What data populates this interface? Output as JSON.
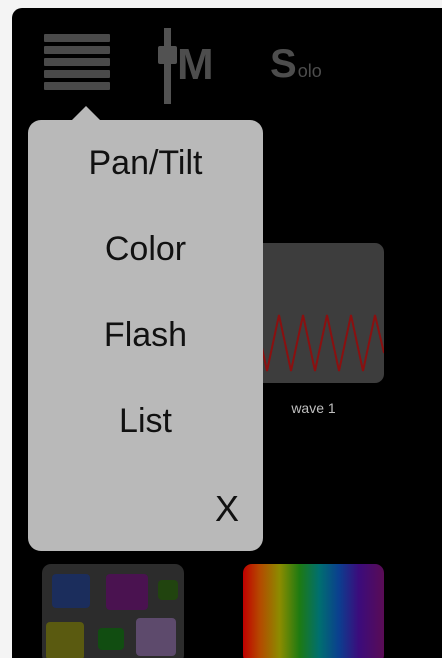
{
  "toolbar": {
    "menu_icon": "hamburger-icon",
    "fader_icon": "fader-icon",
    "master_label": "M",
    "solo_initial": "S",
    "solo_rest": "olo"
  },
  "popup_menu": {
    "items": [
      {
        "label": "Pan/Tilt"
      },
      {
        "label": "Color"
      },
      {
        "label": "Flash"
      },
      {
        "label": "List"
      }
    ],
    "close_label": "X"
  },
  "tiles": {
    "wave_label": "wave 1"
  },
  "colors": {
    "background": "#000000",
    "popup": "#b9b9b9",
    "icon_gray": "#4d4d4d",
    "wave_line": "#8a1010"
  }
}
